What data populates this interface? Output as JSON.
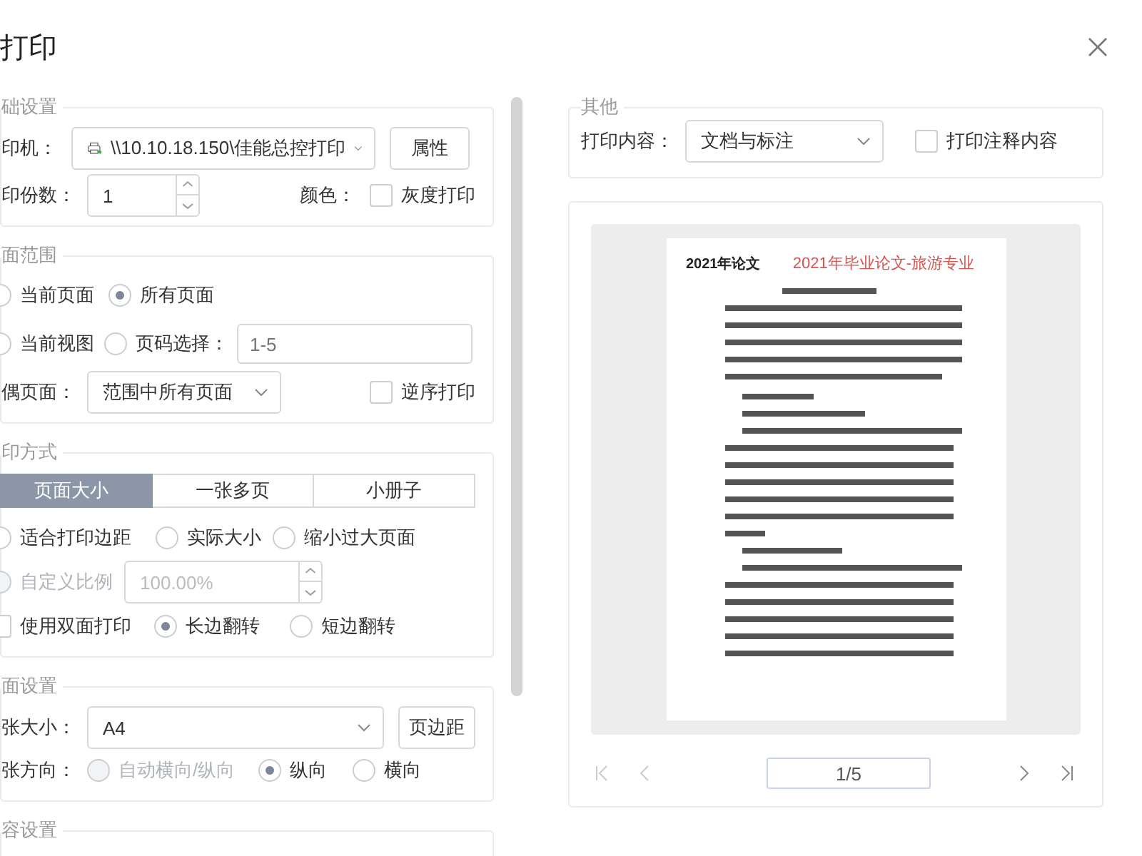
{
  "window": {
    "title": "打印"
  },
  "basic": {
    "legend": "础设置",
    "printer_label": "印机：",
    "printer": "\\\\10.10.18.150\\佳能总控打印",
    "properties_button": "属性",
    "copies_label": "印份数：",
    "copies": "1",
    "color_label": "颜色：",
    "grayscale": {
      "label": "灰度打印",
      "checked": false
    }
  },
  "page_range": {
    "legend": "面范围",
    "options": [
      {
        "label": "当前页面",
        "selected": false
      },
      {
        "label": "所有页面",
        "selected": true
      },
      {
        "label": "当前视图",
        "selected": false
      },
      {
        "label": "页码选择：",
        "selected": false
      }
    ],
    "pages_placeholder": "1-5",
    "odd_even_label": "偶页面：",
    "odd_even": "范围中所有页面",
    "reverse": {
      "label": "逆序打印",
      "checked": false
    }
  },
  "print_mode": {
    "legend": "印方式",
    "tabs": [
      {
        "label": "页面大小",
        "selected": true
      },
      {
        "label": "一张多页",
        "selected": false
      },
      {
        "label": "小册子",
        "selected": false
      }
    ],
    "scaling": [
      {
        "label": "适合打印边距",
        "selected": false
      },
      {
        "label": "实际大小",
        "selected": false
      },
      {
        "label": "缩小过大页面",
        "selected": false
      }
    ],
    "custom_scale": {
      "label": "自定义比例",
      "selected": false,
      "value": "100.00%",
      "disabled": true
    },
    "duplex": {
      "label": "使用双面打印",
      "checked": false
    },
    "flip": [
      {
        "label": "长边翻转",
        "selected": true
      },
      {
        "label": "短边翻转",
        "selected": false
      }
    ]
  },
  "page_setup": {
    "legend": "面设置",
    "size_label": "张大小：",
    "size": "A4",
    "margins_button": "页边距",
    "orientation_label": "张方向：",
    "orientation": [
      {
        "label": "自动横向/纵向",
        "selected": false,
        "disabled": true
      },
      {
        "label": "纵向",
        "selected": true,
        "disabled": false
      },
      {
        "label": "横向",
        "selected": false,
        "disabled": false
      }
    ]
  },
  "content": {
    "legend": "容设置"
  },
  "other": {
    "legend": "其他",
    "content_label": "打印内容：",
    "content": "文档与标注",
    "print_comments": {
      "label": "打印注释内容",
      "checked": false
    }
  },
  "preview": {
    "header": "2021年论文",
    "title": "2021年毕业论文-旅游专业",
    "page": "1/5"
  }
}
